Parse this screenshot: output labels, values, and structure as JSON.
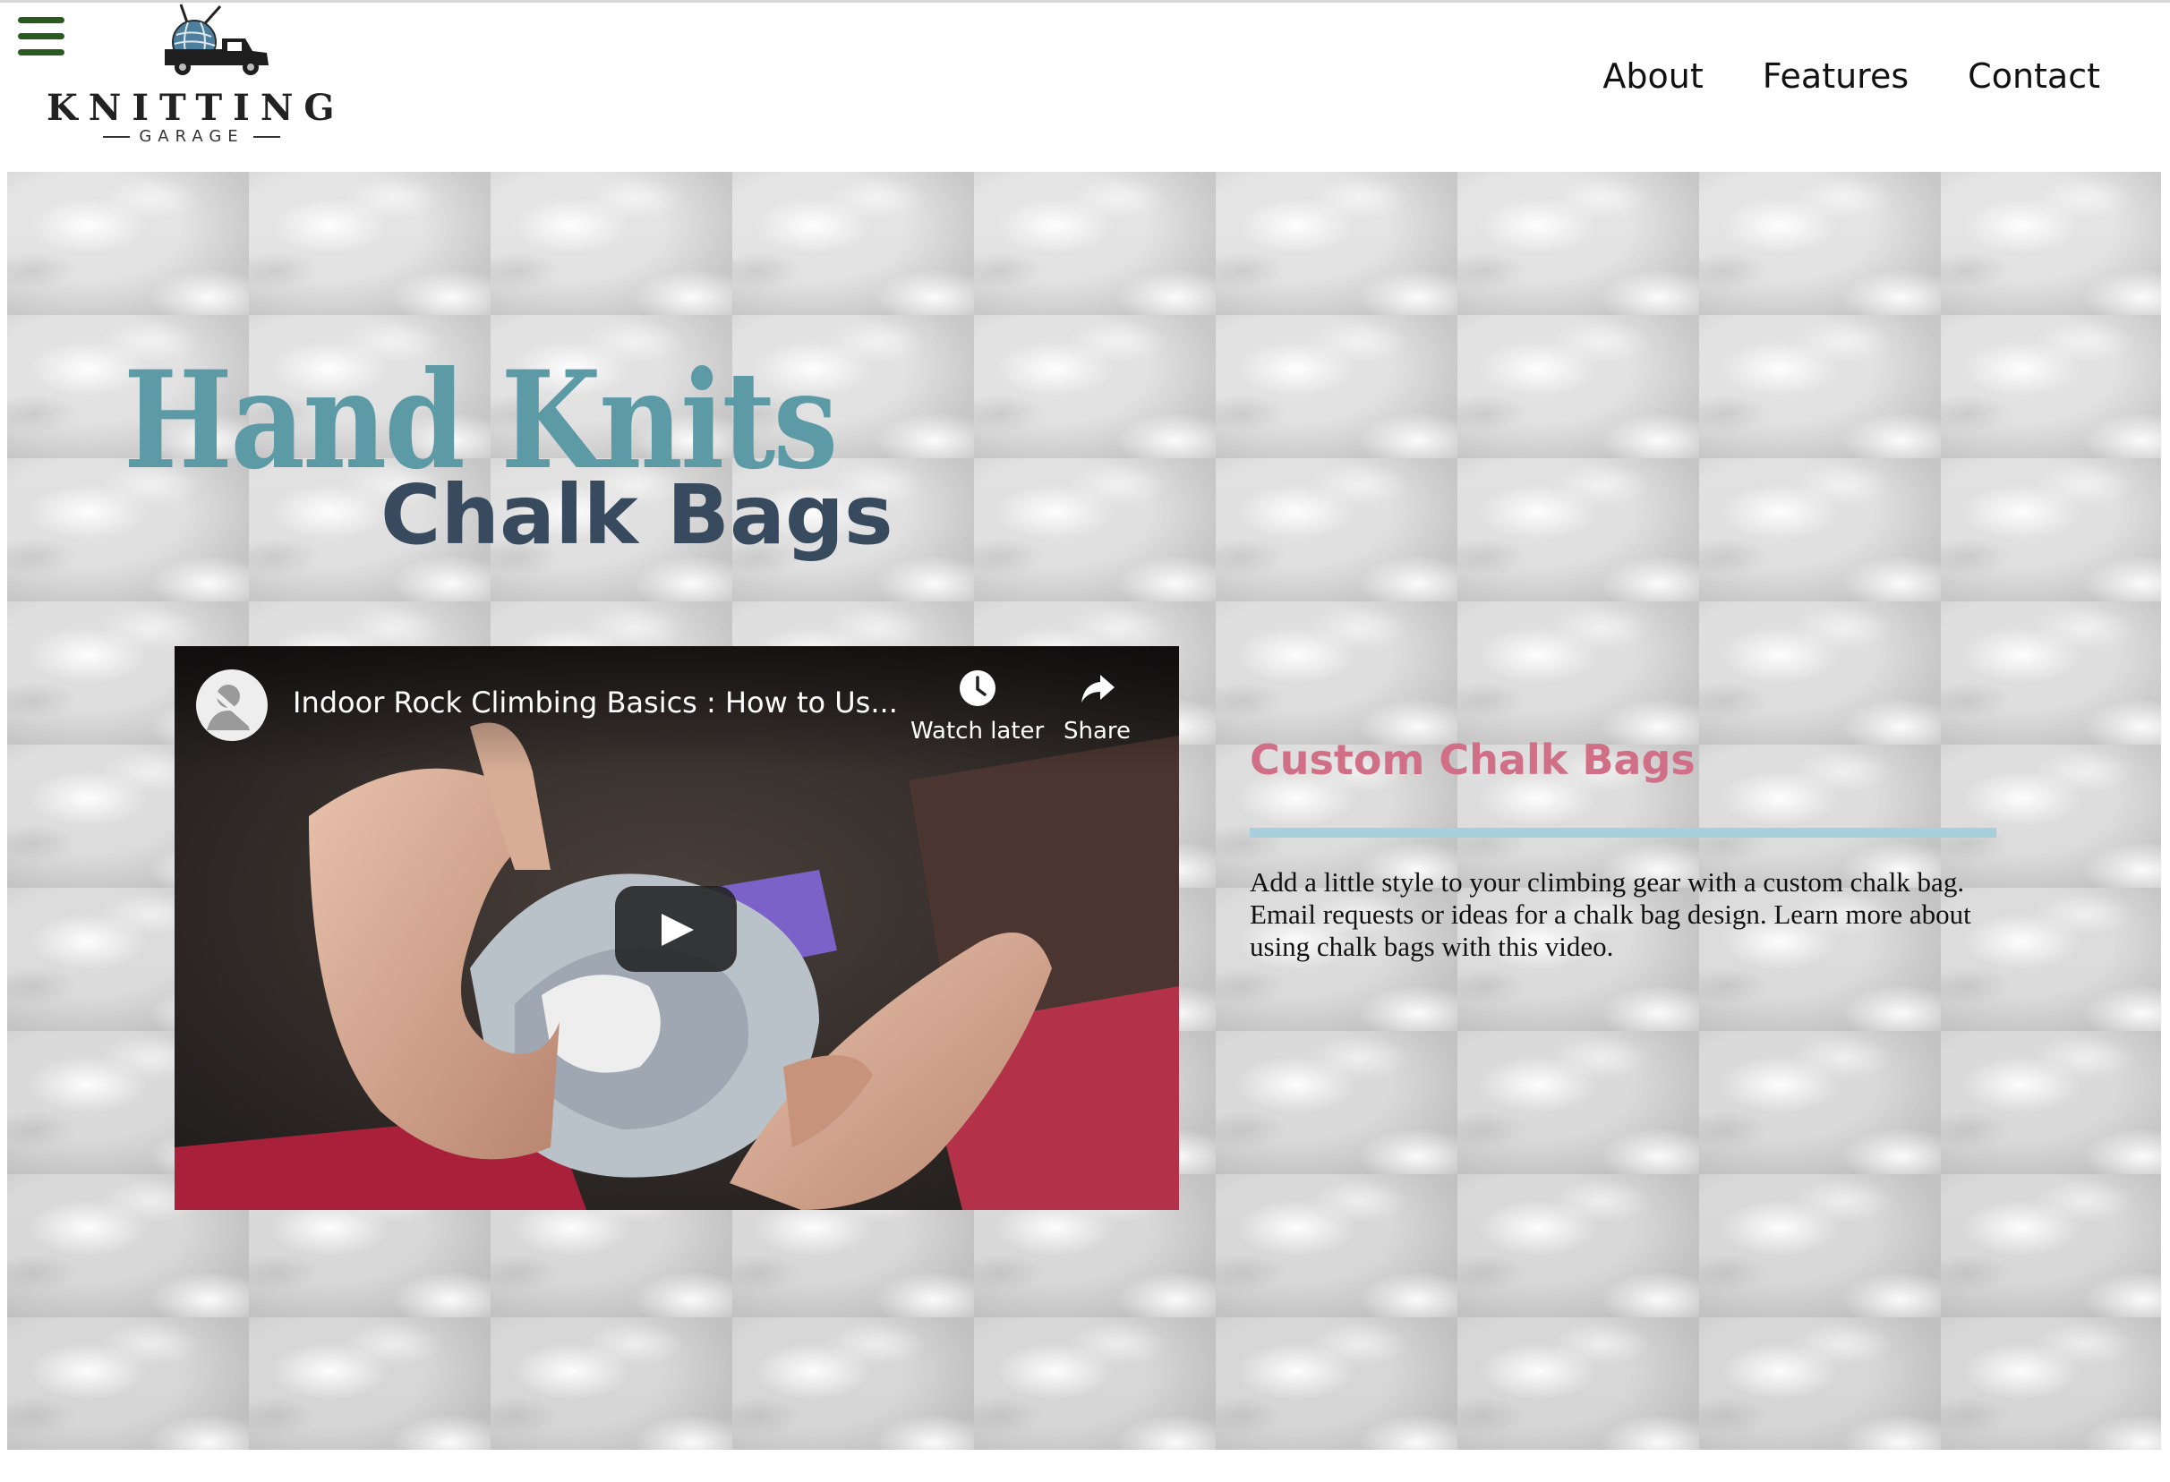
{
  "logo": {
    "name": "KNITTING",
    "subtitle": "GARAGE"
  },
  "nav": {
    "items": [
      "About",
      "Features",
      "Contact"
    ]
  },
  "hero": {
    "title_line1": "Hand Knits",
    "title_line2": "Chalk Bags"
  },
  "video": {
    "title": "Indoor Rock Climbing Basics : How to Us...",
    "watch_later_label": "Watch later",
    "share_label": "Share"
  },
  "section": {
    "heading": "Custom Chalk Bags",
    "body": "Add a little style to your climbing gear with a custom chalk bag. Email requests or ideas for a chalk bag design. Learn more about using chalk bags with this video."
  },
  "colors": {
    "menu_icon": "#2a5a1f",
    "title_primary": "#5c9aa6",
    "title_secondary": "#384a5e",
    "heading_accent": "#d06f86",
    "divider": "#a7cfdc"
  },
  "icons": [
    "menu-icon",
    "yarn-truck-logo",
    "channel-avatar-icon",
    "clock-icon",
    "share-arrow-icon",
    "play-icon"
  ]
}
